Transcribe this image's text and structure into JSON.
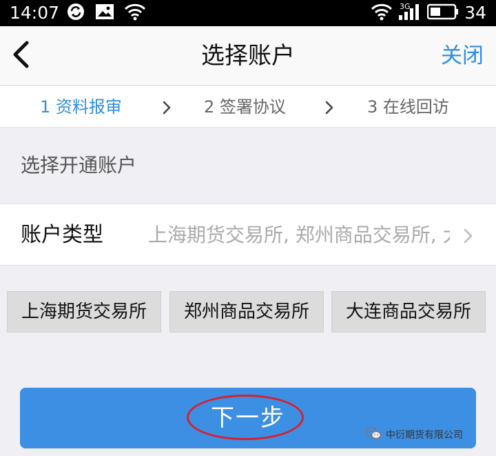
{
  "status_bar": {
    "time": "14:07",
    "network_label": "3G",
    "battery_level": "34",
    "icons": [
      "sync-icon",
      "image-notification-icon",
      "wifi-icon",
      "wifi-icon",
      "signal-icon",
      "battery-icon"
    ]
  },
  "nav": {
    "title": "选择账户",
    "close_label": "关闭",
    "back_icon": "chevron-left-icon"
  },
  "steps": [
    {
      "label": "1 资料报审",
      "active": true
    },
    {
      "label": "2 签署协议",
      "active": false
    },
    {
      "label": "3 在线回访",
      "active": false
    }
  ],
  "section": {
    "header": "选择开通账户"
  },
  "account_type": {
    "label": "账户类型",
    "value": "上海期货交易所, 郑州商品交易所, 大连商品交易所"
  },
  "exchanges": [
    "上海期货交易所",
    "郑州商品交易所",
    "大连商品交易所"
  ],
  "next_button": {
    "label": "下一步"
  },
  "watermark": {
    "text": "中衍期货有限公司"
  },
  "colors": {
    "accent": "#2f8ee0",
    "button": "#3d8fe4",
    "highlight": "#d91f2e",
    "background": "#efeff4"
  }
}
